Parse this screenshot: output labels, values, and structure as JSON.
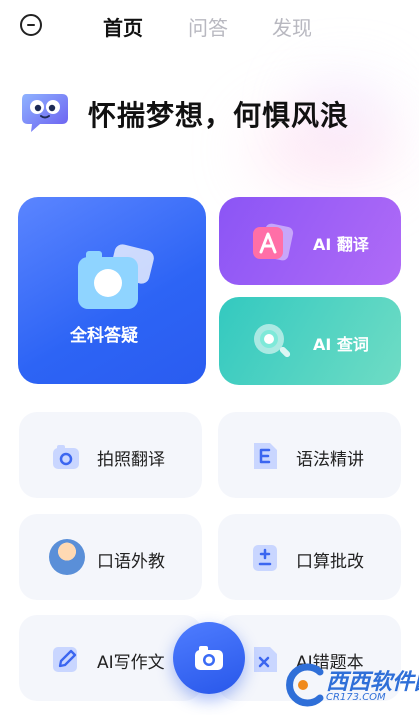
{
  "top_nav": {
    "tabs": [
      {
        "label": "首页",
        "active": true
      },
      {
        "label": "问答",
        "active": false
      },
      {
        "label": "发现",
        "active": false
      }
    ]
  },
  "hero": {
    "slogan": "怀揣梦想，何惧风浪",
    "logo_icon": "chat-bubble-mascot-icon"
  },
  "feature_cards": {
    "main": {
      "label": "全科答疑",
      "icon": "camera-icon",
      "color": "#2d64f5"
    },
    "translate": {
      "label": "AI 翻译",
      "icon": "translate-a-icon",
      "color": "#9a5ff6"
    },
    "word_lookup": {
      "label": "AI 查词",
      "icon": "magnifier-icon",
      "color": "#3fcfc1"
    }
  },
  "tools": [
    {
      "label": "拍照翻译",
      "icon": "camera-icon"
    },
    {
      "label": "语法精讲",
      "icon": "letter-e-icon"
    },
    {
      "label": "口语外教",
      "icon": "avatar-icon"
    },
    {
      "label": "口算批改",
      "icon": "plus-minus-icon"
    },
    {
      "label": "AI写作文",
      "icon": "pencil-icon"
    },
    {
      "label": "AI错题本",
      "icon": "cross-note-icon"
    }
  ],
  "fab": {
    "icon": "camera-icon",
    "color": "#3a6bf5"
  },
  "watermark": {
    "text": "西西软件园",
    "sub": "CR173.COM"
  }
}
